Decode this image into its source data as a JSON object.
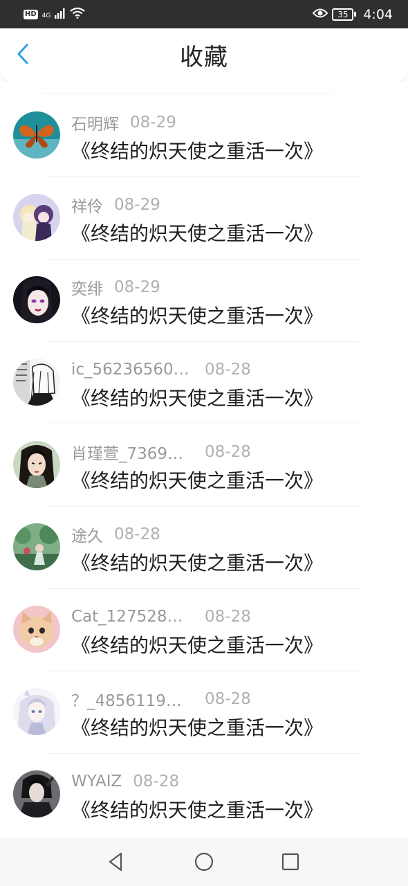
{
  "status_bar": {
    "hd": "HD",
    "network": "4G",
    "battery": "35",
    "time": "4:04"
  },
  "header": {
    "title": "收藏",
    "back_icon": "chevron-left-icon",
    "accent_color": "#2a9ee8"
  },
  "favorites": [
    {
      "user": "石明辉",
      "date": "08-29",
      "book": "《终结的炽天使之重活一次》",
      "avatar": "butterfly-avatar"
    },
    {
      "user": "祥伶",
      "date": "08-29",
      "book": "《终结的炽天使之重活一次》",
      "avatar": "anime-pair-avatar"
    },
    {
      "user": "奕绯",
      "date": "08-29",
      "book": "《终结的炽天使之重活一次》",
      "avatar": "dark-hair-girl-avatar"
    },
    {
      "user": "ic_56236560…",
      "date": "08-28",
      "book": "《终结的炽天使之重活一次》",
      "avatar": "manga-avatar"
    },
    {
      "user": "肖瑾萱_7369…",
      "date": "08-28",
      "book": "《终结的炽天使之重活一次》",
      "avatar": "longhair-man-avatar"
    },
    {
      "user": "途久",
      "date": "08-28",
      "book": "《终结的炽天使之重活一次》",
      "avatar": "green-scene-avatar"
    },
    {
      "user": "Cat_127528…",
      "date": "08-28",
      "book": "《终结的炽天使之重活一次》",
      "avatar": "cat-avatar"
    },
    {
      "user": "？_4856119…",
      "date": "08-28",
      "book": "《终结的炽天使之重活一次》",
      "avatar": "white-hair-girl-avatar"
    },
    {
      "user": "WYAIZ",
      "date": "08-28",
      "book": "《终结的炽天使之重活一次》",
      "avatar": "dark-warrior-avatar"
    }
  ],
  "nav": {
    "back": "nav-back-icon",
    "home": "nav-home-icon",
    "recent": "nav-recent-icon"
  }
}
